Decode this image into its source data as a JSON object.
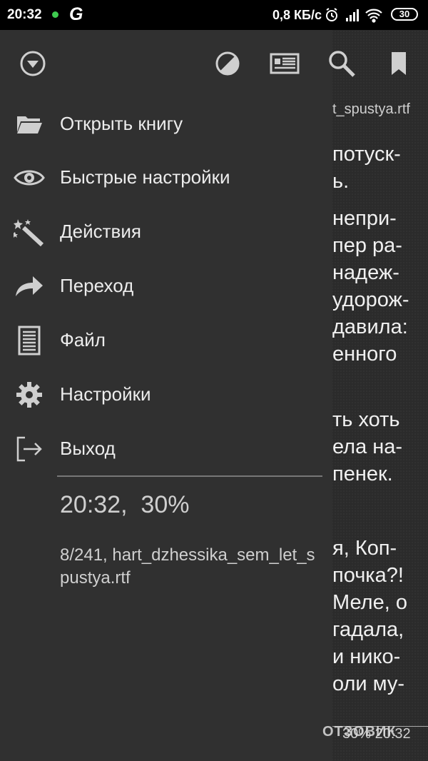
{
  "status_bar": {
    "time": "20:32",
    "app_letter": "G",
    "network_speed": "0,8 КБ/с",
    "battery": "30"
  },
  "toolbar": {
    "icons": [
      "dropdown-icon",
      "day-night-icon",
      "contents-icon",
      "search-icon",
      "bookmark-icon"
    ]
  },
  "menu": {
    "items": [
      {
        "label": "Открыть книгу",
        "icon": "folder-icon"
      },
      {
        "label": "Быстрые настройки",
        "icon": "eye-icon"
      },
      {
        "label": "Действия",
        "icon": "magic-wand-icon"
      },
      {
        "label": "Переход",
        "icon": "arrow-forward-icon"
      },
      {
        "label": "Файл",
        "icon": "file-icon"
      },
      {
        "label": "Настройки",
        "icon": "gear-icon"
      },
      {
        "label": "Выход",
        "icon": "exit-icon"
      }
    ]
  },
  "info": {
    "clock_battery": "20:32,  30%",
    "book": "8/241, hart_dzhessika_sem_let_spustya.rtf"
  },
  "reader": {
    "filename": "t_spustya.rtf",
    "lines": [
      "потуск-",
      "ь.",
      "непри-",
      "пер ра-",
      "надеж-",
      "удорож-",
      "давила:",
      "енного",
      "ть  хоть",
      "ела  на-",
      "пенек.",
      "я,  Коп-",
      "почка?!",
      "Меле, о",
      "гадала,",
      "и нико-",
      "оли му-"
    ],
    "footer": "30% 20:32"
  },
  "watermark": "ОТЗОВИК"
}
